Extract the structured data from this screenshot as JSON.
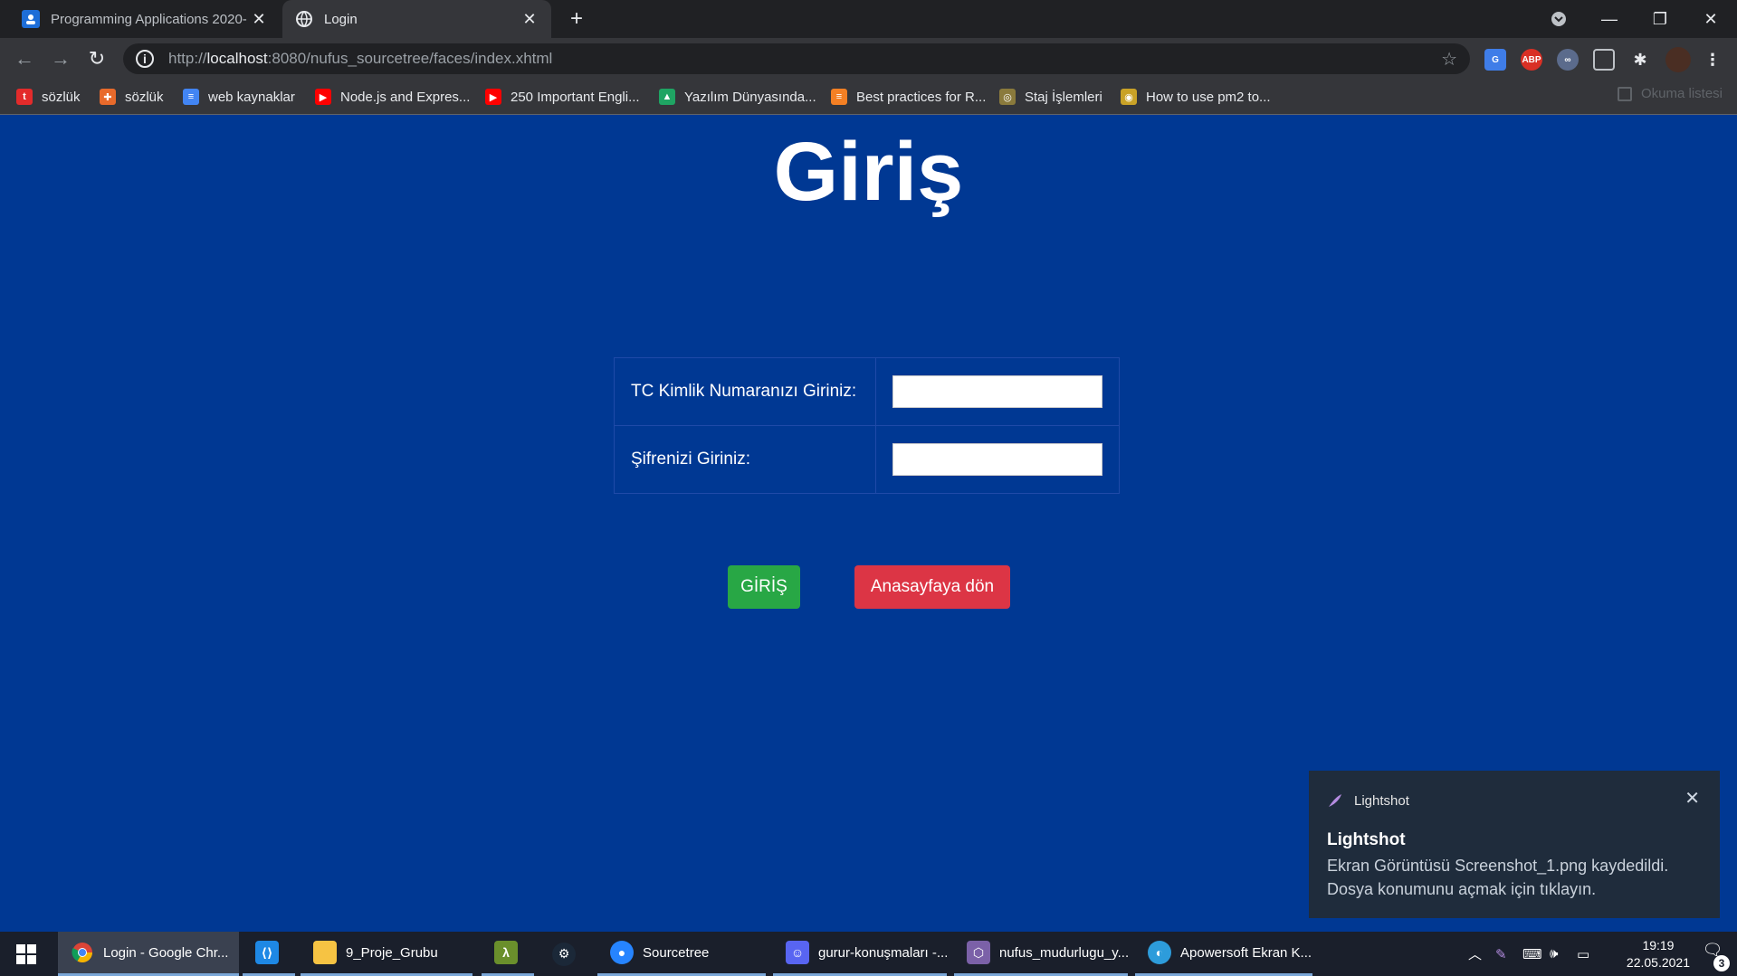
{
  "browser": {
    "tabs": [
      {
        "title": "Programming Applications 2020-",
        "icon": "classroom-icon",
        "active": false
      },
      {
        "title": "Login",
        "icon": "globe-icon",
        "active": true
      }
    ],
    "new_tab_label": "+",
    "url_prefix": "http://",
    "url_host": "localhost",
    "url_rest": ":8080/nufus_sourcetree/faces/index.xhtml",
    "extensions": [
      "translate-icon",
      "adblock-icon",
      "extension-icon",
      "shield-icon",
      "puzzle-icon",
      "avatar"
    ],
    "extension_labels": {
      "adblock": "ABP"
    }
  },
  "bookmarks": {
    "items": [
      {
        "label": "sözlük",
        "icon": "eksi-icon",
        "color": "#e32b2b",
        "glyph": "t"
      },
      {
        "label": "sözlük",
        "icon": "ethz-icon",
        "color": "#e86a2b",
        "glyph": "✚"
      },
      {
        "label": "web kaynaklar",
        "icon": "docs-icon",
        "color": "#4285f4",
        "glyph": "≡"
      },
      {
        "label": "Node.js and Expres...",
        "icon": "youtube-icon",
        "color": "#ff0000",
        "glyph": "▶"
      },
      {
        "label": "250 Important Engli...",
        "icon": "youtube-icon",
        "color": "#ff0000",
        "glyph": "▶"
      },
      {
        "label": "Yazılım Dünyasında...",
        "icon": "drive-icon",
        "color": "#1fa463",
        "glyph": "▲"
      },
      {
        "label": "Best practices for R...",
        "icon": "stackoverflow-icon",
        "color": "#f48024",
        "glyph": "≡"
      },
      {
        "label": "Staj İşlemleri",
        "icon": "university-icon",
        "color": "#8a7a3c",
        "glyph": "◎"
      },
      {
        "label": "How to use pm2 to...",
        "icon": "pm2-icon",
        "color": "#c9a227",
        "glyph": "◉"
      }
    ],
    "reading_list": "Okuma listesi"
  },
  "page": {
    "title": "Giriş",
    "tc_label": "TC Kimlik Numaranızı Giriniz:",
    "tc_value": "",
    "password_label": "Şifrenizi Giriniz:",
    "password_value": "",
    "login_button": "GİRİŞ",
    "home_button": "Anasayfaya dön",
    "colors": {
      "background": "#003893",
      "login": "#28a745",
      "home": "#dc3545"
    }
  },
  "notification": {
    "app": "Lightshot",
    "title": "Lightshot",
    "message": "Ekran Görüntüsü Screenshot_1.png kaydedildi. Dosya konumunu açmak için tıklayın."
  },
  "taskbar": {
    "items": [
      {
        "label": "Login - Google Chr...",
        "icon": "chrome-icon"
      },
      {
        "label": "",
        "icon": "vscode-icon"
      },
      {
        "label": "9_Proje_Grubu",
        "icon": "folder-icon"
      },
      {
        "label": "",
        "icon": "lambda-icon"
      },
      {
        "label": "",
        "icon": "steam-icon"
      },
      {
        "label": "Sourcetree",
        "icon": "sourcetree-icon"
      },
      {
        "label": "gurur-konuşmaları -...",
        "icon": "discord-icon"
      },
      {
        "label": "nufus_mudurlugu_y...",
        "icon": "netbeans-icon"
      },
      {
        "label": "Apowersoft Ekran K...",
        "icon": "apowersoft-icon"
      }
    ],
    "time": "19:19",
    "date": "22.05.2021",
    "notification_count": "3"
  }
}
